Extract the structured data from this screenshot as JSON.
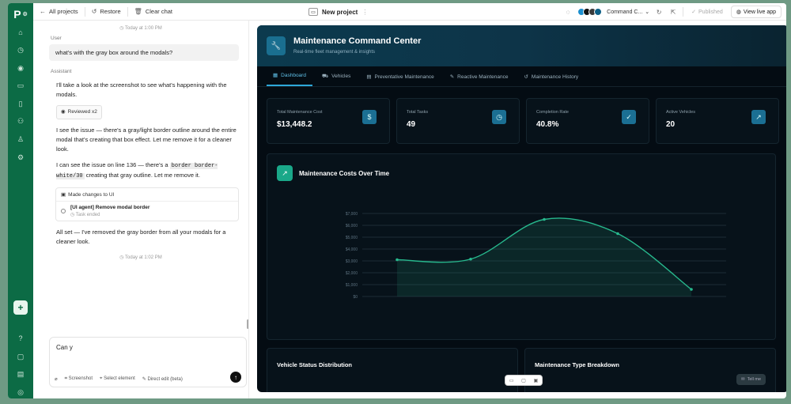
{
  "topbar": {
    "all_projects": "All projects",
    "restore": "Restore",
    "clear_chat": "Clear chat",
    "project_name": "New project",
    "mode": "Command C...",
    "published": "Published",
    "view_live": "View live app"
  },
  "chat": {
    "ts1": "Today at 1:00 PM",
    "user_role": "User",
    "user_msg": "what's with the gray box around the modals?",
    "assistant_role": "Assistant",
    "a1": "I'll take a look at the screenshot to see what's happening with the modals.",
    "reviewed": "Reviewed x2",
    "a2": "I see the issue — there's a gray/light border outline around the entire modal that's creating that box effect. Let me remove it for a cleaner look.",
    "a3_pre": "I can see the issue on line 136 — there's a",
    "a3_code": "border border-white/30",
    "a3_post": "creating that gray outline. Let me remove it.",
    "changes_label": "Made changes to UI",
    "task_title": "[UI agent] Remove modal border",
    "task_status": "Task ended",
    "a4": "All set — I've removed the gray border from all your modals for a cleaner look.",
    "ts2": "Today at 1:02 PM",
    "input_value": "Can y",
    "tools": {
      "screenshot": "Screenshot",
      "select": "Select element",
      "direct": "Direct edit (beta)"
    }
  },
  "preview": {
    "title": "Maintenance Command Center",
    "subtitle": "Real-time fleet management & insights",
    "tabs": [
      "Dashboard",
      "Vehicles",
      "Preventative Maintenance",
      "Reactive Maintenance",
      "Maintenance History"
    ],
    "cards": [
      {
        "label": "Total Maintenance Cost",
        "value": "$13,448.2",
        "icon": "dollar-icon"
      },
      {
        "label": "Total Tasks",
        "value": "49",
        "icon": "clock-icon"
      },
      {
        "label": "Completion Rate",
        "value": "40.8%",
        "icon": "check-circle-icon"
      },
      {
        "label": "Active Vehicles",
        "value": "20",
        "icon": "trend-up-icon"
      }
    ],
    "chart_title": "Maintenance Costs Over Time",
    "vehicle_status": "Vehicle Status Distribution",
    "type_breakdown": "Maintenance Type Breakdown",
    "tell": "Tell me"
  },
  "chart_data": {
    "type": "area",
    "title": "Maintenance Costs Over Time",
    "y_ticks": [
      "$0",
      "$1,000",
      "$2,000",
      "$3,000",
      "$4,000",
      "$5,000",
      "$6,000",
      "$7,000"
    ],
    "ylim": [
      0,
      7000
    ],
    "x": [
      "",
      "",
      "",
      "",
      ""
    ],
    "values": [
      3100,
      3150,
      6500,
      5300,
      600
    ],
    "accent": "#27b88d"
  }
}
